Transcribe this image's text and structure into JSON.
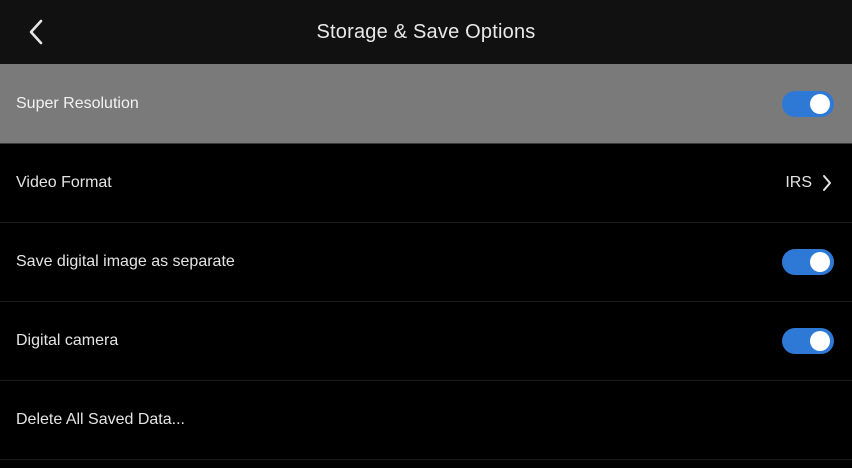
{
  "header": {
    "title": "Storage & Save Options",
    "back_icon": "chevron-left-icon"
  },
  "colors": {
    "background": "#000000",
    "header_background": "#111111",
    "highlight_background": "#7a7a7a",
    "toggle_on": "#2f79d6",
    "text": "#e4e4e4"
  },
  "settings": [
    {
      "label": "Super Resolution",
      "control": "toggle",
      "on": true,
      "highlighted": true
    },
    {
      "label": "Video Format",
      "control": "value",
      "value": "IRS",
      "icon": "chevron-right-icon"
    },
    {
      "label": "Save digital image as separate",
      "control": "toggle",
      "on": true
    },
    {
      "label": "Digital camera",
      "control": "toggle",
      "on": true
    },
    {
      "label": "Delete All Saved Data...",
      "control": "action"
    }
  ]
}
